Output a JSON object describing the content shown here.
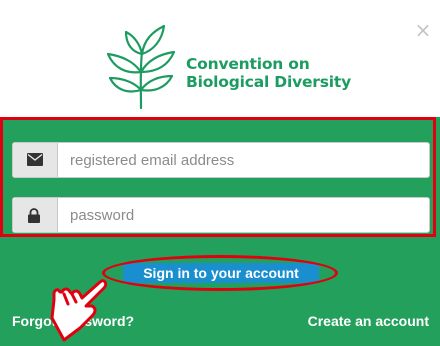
{
  "dialog": {
    "close_label": "×",
    "logo": {
      "line1": "Convention on",
      "line2": "Biological Diversity",
      "icon": "plant-leaves-icon",
      "color": "#1d9c61"
    }
  },
  "login_form": {
    "email": {
      "placeholder": "registered email address",
      "value": "",
      "icon": "envelope-icon"
    },
    "password": {
      "placeholder": "password",
      "value": "",
      "icon": "lock-icon"
    },
    "signin_label": "Sign in to your account",
    "forgot_label": "Forgot password?",
    "create_label": "Create an account"
  },
  "colors": {
    "form_background": "#23a05b",
    "signin_button": "#1a8fd0",
    "highlight": "#e1000f"
  },
  "annotations": {
    "pointer": "pointing-hand-icon"
  }
}
